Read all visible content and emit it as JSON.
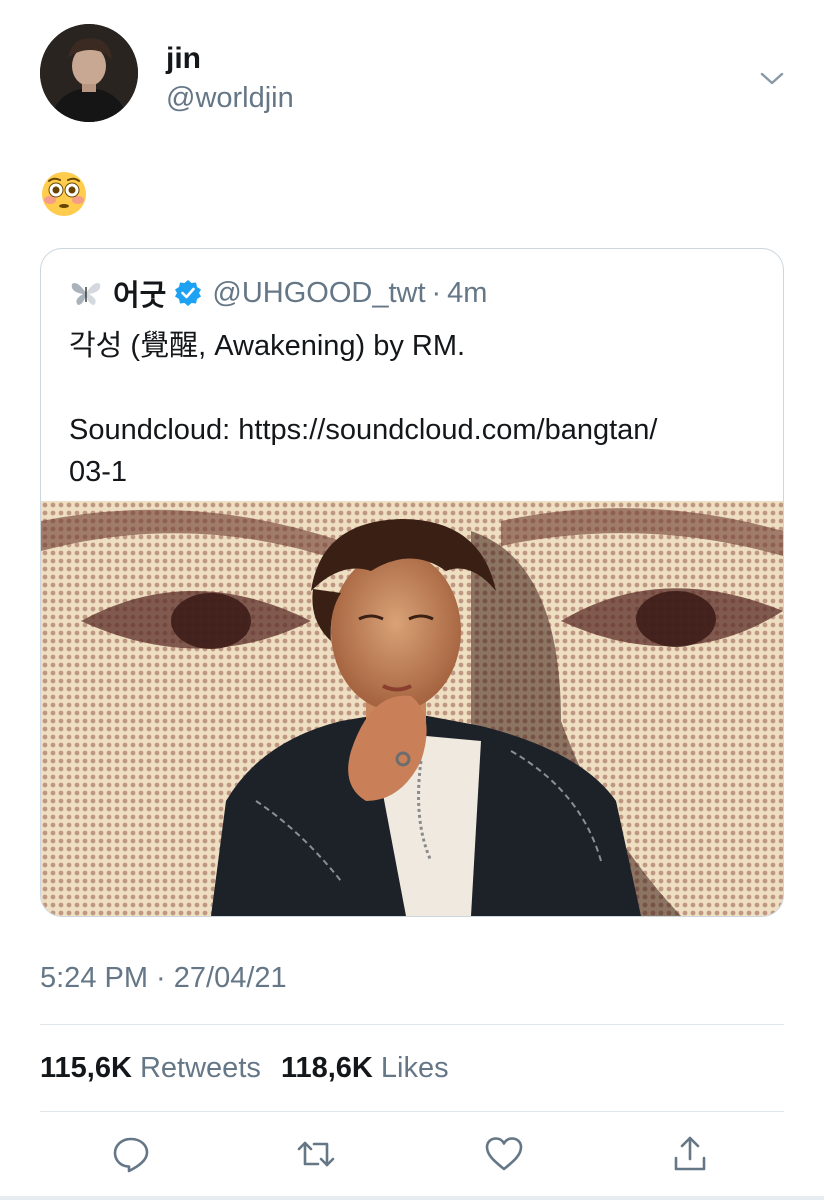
{
  "tweet": {
    "author_name": "jin",
    "author_handle": "@worldjin",
    "text_emoji": "😳",
    "timestamp": "5:24 PM · 27/04/21",
    "retweets_count": "115,6K",
    "retweets_label": "Retweets",
    "likes_count": "118,6K",
    "likes_label": "Likes"
  },
  "quoted": {
    "name": "어굿",
    "handle": "@UHGOOD_twt",
    "separator": "·",
    "time": "4m",
    "line1": "각성 (覺醒, Awakening) by RM.",
    "line2": "Soundcloud: https://soundcloud.com/bangtan/",
    "line3": "03-1"
  },
  "icons": {
    "more": "chevron-down-icon",
    "reply": "reply-icon",
    "retweet": "retweet-icon",
    "like": "heart-icon",
    "share": "share-icon",
    "verified": "verified-badge-icon"
  },
  "colors": {
    "accent": "#1da1f2",
    "secondary_text": "#657786",
    "divider": "#e1e8ed"
  }
}
